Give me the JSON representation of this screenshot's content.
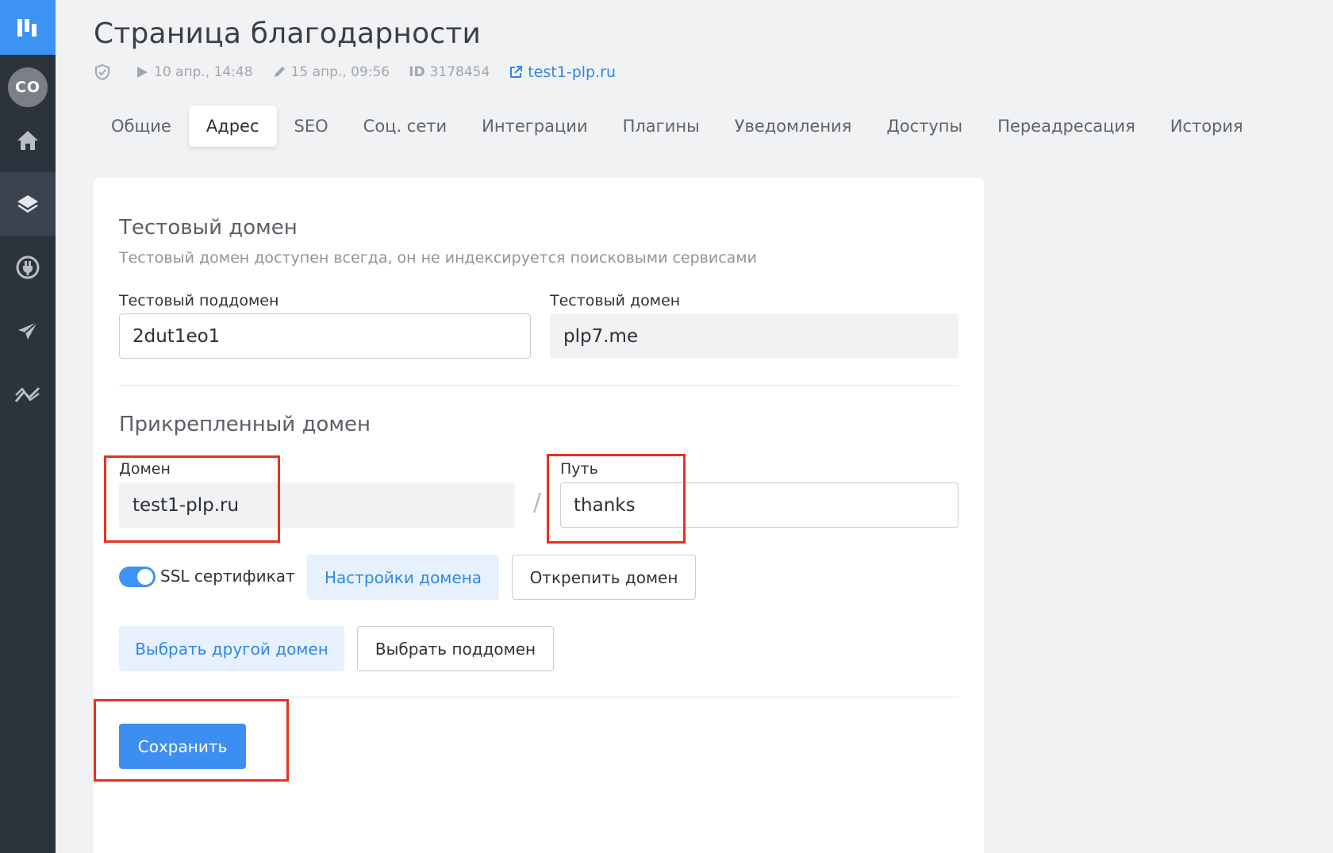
{
  "colors": {
    "sidebar": "#2c333d",
    "accent": "#3d93f2",
    "highlight": "#e8321f"
  },
  "sidebar": {
    "avatar_initials": "CO",
    "items": [
      {
        "icon": "home-icon"
      },
      {
        "icon": "layers-icon",
        "active": true
      },
      {
        "icon": "plug-icon"
      },
      {
        "icon": "send-icon"
      },
      {
        "icon": "analytics-icon"
      }
    ]
  },
  "page": {
    "title": "Страница благодарности",
    "meta": {
      "published": "10 апр., 14:48",
      "edited": "15 апр., 09:56",
      "id_label": "ID",
      "id_value": "3178454",
      "link": "test1-plp.ru"
    }
  },
  "tabs": [
    {
      "label": "Общие"
    },
    {
      "label": "Адрес",
      "active": true
    },
    {
      "label": "SEO"
    },
    {
      "label": "Соц. сети"
    },
    {
      "label": "Интеграции"
    },
    {
      "label": "Плагины"
    },
    {
      "label": "Уведомления"
    },
    {
      "label": "Доступы"
    },
    {
      "label": "Переадресация"
    },
    {
      "label": "История"
    }
  ],
  "test_domain": {
    "title": "Тестовый домен",
    "subtitle": "Тестовый домен доступен всегда, он не индексируется поисковыми сервисами",
    "subdomain_label": "Тестовый поддомен",
    "subdomain_value": "2dut1eo1",
    "domain_label": "Тестовый домен",
    "domain_value": "plp7.me"
  },
  "attached_domain": {
    "title": "Прикрепленный домен",
    "domain_label": "Домен",
    "domain_value": "test1-plp.ru",
    "separator": "/",
    "path_label": "Путь",
    "path_value": "thanks",
    "ssl_label": "SSL сертификат",
    "ssl_enabled": true,
    "domain_settings_button": "Настройки домена",
    "detach_button": "Открепить домен",
    "choose_domain_button": "Выбрать другой домен",
    "choose_subdomain_button": "Выбрать поддомен",
    "save_button": "Сохранить"
  }
}
